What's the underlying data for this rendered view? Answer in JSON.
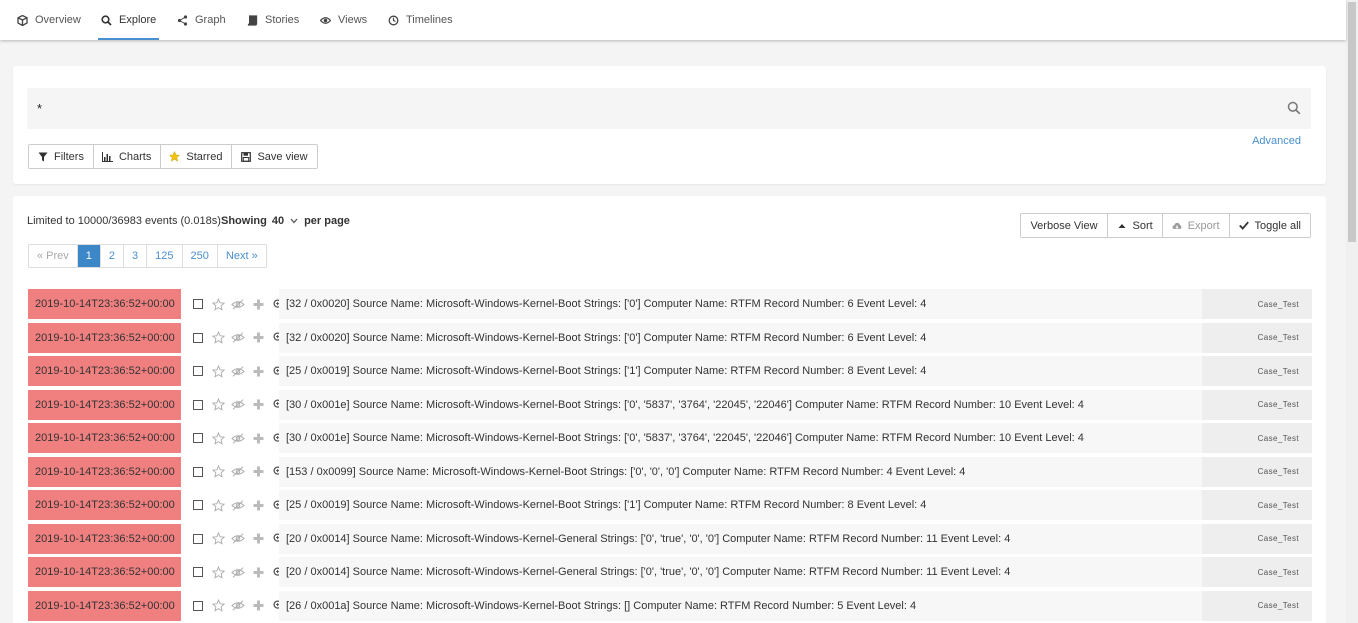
{
  "nav": {
    "tabs": [
      {
        "label": "Overview",
        "icon": "cube-icon"
      },
      {
        "label": "Explore",
        "icon": "search-icon",
        "active": true
      },
      {
        "label": "Graph",
        "icon": "share-icon"
      },
      {
        "label": "Stories",
        "icon": "book-icon"
      },
      {
        "label": "Views",
        "icon": "eye-icon"
      },
      {
        "label": "Timelines",
        "icon": "clock-icon"
      }
    ]
  },
  "search": {
    "query": "*",
    "advanced_label": "Advanced",
    "buttons": {
      "filters": "Filters",
      "charts": "Charts",
      "starred": "Starred",
      "save_view": "Save view"
    }
  },
  "results": {
    "limited_text": "Limited to 10000/36983 events (0.018s)",
    "showing_label": "Showing",
    "per_page_value": "40",
    "per_page_label": "per page",
    "toolbar": {
      "verbose_view": "Verbose View",
      "sort": "Sort",
      "export": "Export",
      "toggle_all": "Toggle all"
    },
    "pagination": {
      "prev": "« Prev",
      "pages": [
        "1",
        "2",
        "3",
        "125",
        "250"
      ],
      "active_page": "1",
      "next": "Next »"
    }
  },
  "colors": {
    "accent": "#4a8fd0",
    "timestamp_bg": "#f08080",
    "active_page_bg": "#3c87c8"
  },
  "events": [
    {
      "timestamp": "2019-10-14T23:36:52+00:00",
      "message": "[32 / 0x0020] Source Name: Microsoft-Windows-Kernel-Boot Strings: ['0'] Computer Name: RTFM Record Number: 6 Event Level: 4",
      "timeline": "Case_Test"
    },
    {
      "timestamp": "2019-10-14T23:36:52+00:00",
      "message": "[32 / 0x0020] Source Name: Microsoft-Windows-Kernel-Boot Strings: ['0'] Computer Name: RTFM Record Number: 6 Event Level: 4",
      "timeline": "Case_Test"
    },
    {
      "timestamp": "2019-10-14T23:36:52+00:00",
      "message": "[25 / 0x0019] Source Name: Microsoft-Windows-Kernel-Boot Strings: ['1'] Computer Name: RTFM Record Number: 8 Event Level: 4",
      "timeline": "Case_Test"
    },
    {
      "timestamp": "2019-10-14T23:36:52+00:00",
      "message": "[30 / 0x001e] Source Name: Microsoft-Windows-Kernel-Boot Strings: ['0', '5837', '3764', '22045', '22046'] Computer Name: RTFM Record Number: 10 Event Level: 4",
      "timeline": "Case_Test"
    },
    {
      "timestamp": "2019-10-14T23:36:52+00:00",
      "message": "[30 / 0x001e] Source Name: Microsoft-Windows-Kernel-Boot Strings: ['0', '5837', '3764', '22045', '22046'] Computer Name: RTFM Record Number: 10 Event Level: 4",
      "timeline": "Case_Test"
    },
    {
      "timestamp": "2019-10-14T23:36:52+00:00",
      "message": "[153 / 0x0099] Source Name: Microsoft-Windows-Kernel-Boot Strings: ['0', '0', '0'] Computer Name: RTFM Record Number: 4 Event Level: 4",
      "timeline": "Case_Test"
    },
    {
      "timestamp": "2019-10-14T23:36:52+00:00",
      "message": "[25 / 0x0019] Source Name: Microsoft-Windows-Kernel-Boot Strings: ['1'] Computer Name: RTFM Record Number: 8 Event Level: 4",
      "timeline": "Case_Test"
    },
    {
      "timestamp": "2019-10-14T23:36:52+00:00",
      "message": "[20 / 0x0014] Source Name: Microsoft-Windows-Kernel-General Strings: ['0', 'true', '0', '0'] Computer Name: RTFM Record Number: 11 Event Level: 4",
      "timeline": "Case_Test"
    },
    {
      "timestamp": "2019-10-14T23:36:52+00:00",
      "message": "[20 / 0x0014] Source Name: Microsoft-Windows-Kernel-General Strings: ['0', 'true', '0', '0'] Computer Name: RTFM Record Number: 11 Event Level: 4",
      "timeline": "Case_Test"
    },
    {
      "timestamp": "2019-10-14T23:36:52+00:00",
      "message": "[26 / 0x001a] Source Name: Microsoft-Windows-Kernel-Boot Strings: [] Computer Name: RTFM Record Number: 5 Event Level: 4",
      "timeline": "Case_Test"
    }
  ]
}
